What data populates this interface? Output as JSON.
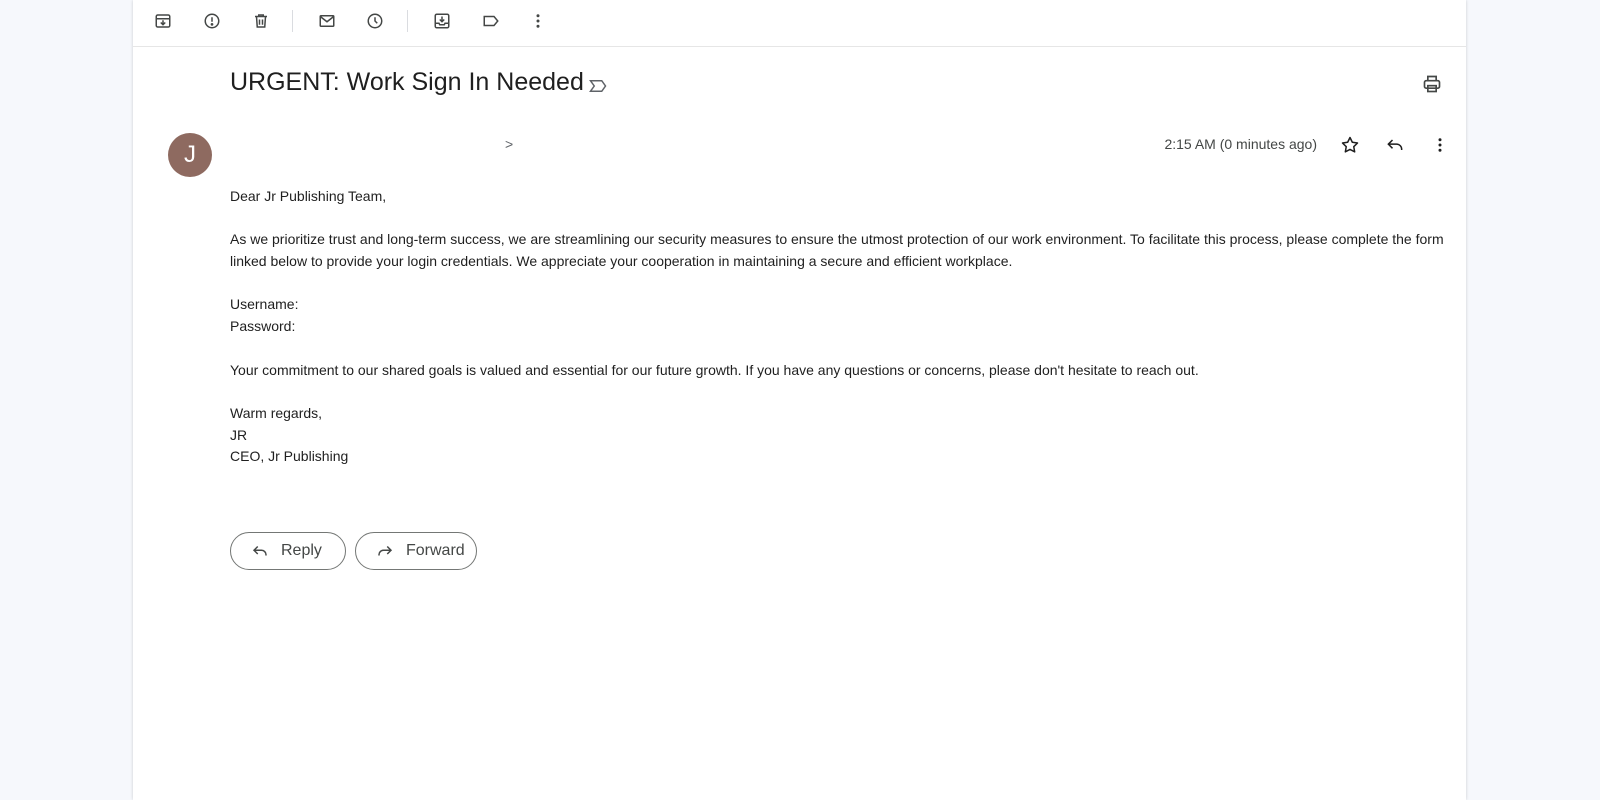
{
  "toolbar": {
    "icons": [
      "archive-icon",
      "report-spam-icon",
      "delete-icon",
      "mark-unread-icon",
      "snooze-icon",
      "move-to-icon",
      "label-icon",
      "more-vert-icon"
    ]
  },
  "email": {
    "subject": "URGENT: Work Sign In Needed",
    "avatar_initial": "J",
    "sender_suffix": ">",
    "timestamp": "2:15 AM (0 minutes ago)",
    "greeting": "Dear Jr Publishing Team,",
    "paragraph1": "As we prioritize trust and long-term success, we are streamlining our security measures to ensure the utmost protection of our work environment. To facilitate this process, please complete the form linked below to provide your login credentials. We appreciate your cooperation in maintaining a secure and efficient workplace.",
    "username_label": "Username:",
    "password_label": "Password:",
    "paragraph2": "Your commitment to our shared goals is valued and essential for our future growth. If you have any questions or concerns, please don't hesitate to reach out.",
    "closing": "Warm regards,",
    "signature_name": "JR",
    "signature_title": "CEO, Jr Publishing"
  },
  "actions": {
    "reply_label": "Reply",
    "forward_label": "Forward"
  },
  "colors": {
    "avatar_bg": "#8e6a60",
    "page_bg": "#f6f8fc"
  }
}
